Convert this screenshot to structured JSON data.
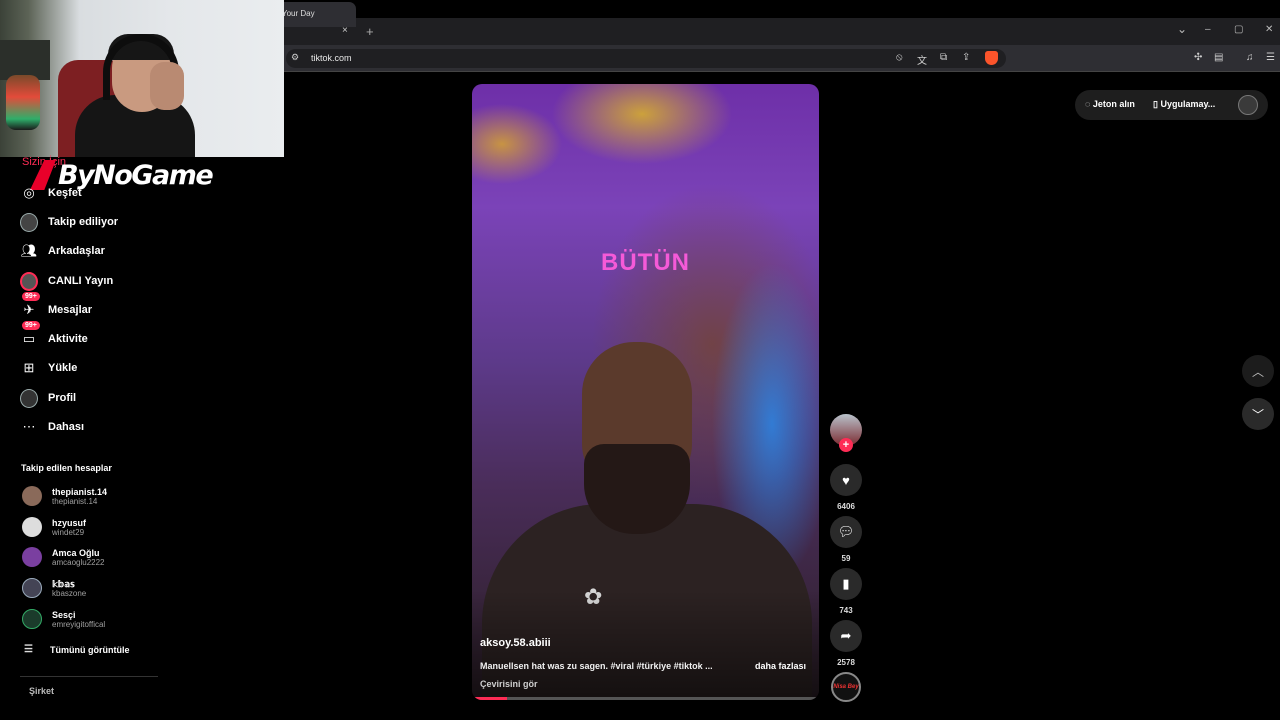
{
  "browser": {
    "tab_title": "Your Day",
    "tab_close": "×",
    "new_tab": "+",
    "url": "tiktok.com",
    "win_min": "–",
    "win_restore": "▢",
    "win_close": "✕",
    "tab_list": "⌄"
  },
  "overlay": {
    "logo_text": "ByNoGame",
    "home_label": "Sizin İçin"
  },
  "sidebar": {
    "items": [
      {
        "label": "Keşfet",
        "icon": "compass-icon"
      },
      {
        "label": "Takip ediliyor",
        "icon": "following-avatar-icon"
      },
      {
        "label": "Arkadaşlar",
        "icon": "friends-icon"
      },
      {
        "label": "CANLI Yayın",
        "icon": "live-icon"
      },
      {
        "label": "Mesajlar",
        "icon": "messages-icon",
        "badge": "99+"
      },
      {
        "label": "Aktivite",
        "icon": "activity-icon",
        "badge": "99+"
      },
      {
        "label": "Yükle",
        "icon": "upload-icon"
      },
      {
        "label": "Profil",
        "icon": "profile-icon"
      },
      {
        "label": "Dahası",
        "icon": "more-icon"
      }
    ],
    "following_title": "Takip edilen hesaplar",
    "accounts": [
      {
        "name": "thepianist.14",
        "id": "thepianist.14",
        "color": "#8a6a5a"
      },
      {
        "name": "hzyusuf",
        "id": "windet29",
        "color": "#ddd"
      },
      {
        "name": "Amca Oğlu",
        "id": "amcaoglu2222",
        "color": "#7a3fa0"
      },
      {
        "name": "𝕜𝕓𝕒𝕤",
        "id": "kbaszone",
        "color": "#445"
      },
      {
        "name": "Sesçi",
        "id": "emreyigitoffical",
        "color": "#1b3b2b"
      }
    ],
    "see_all": "Tümünü görüntüle",
    "company": "Şirket"
  },
  "video": {
    "overlay_text": "BÜTÜN",
    "author": "aksoy.58.abiii",
    "caption": "Manuellsen hat was zu sagen. #viral #türkiye #tiktok ...",
    "more": "daha fazlası",
    "translate": "Çevirisini gör",
    "progress": 0.1,
    "accent": "#fe2c55"
  },
  "actions": {
    "follow": "+",
    "likes": "6406",
    "comments": "59",
    "saves": "743",
    "shares": "2578",
    "music_label": "Nisa Bey"
  },
  "topright": {
    "coins": "Jeton alın",
    "app": "Uygulamay..."
  }
}
